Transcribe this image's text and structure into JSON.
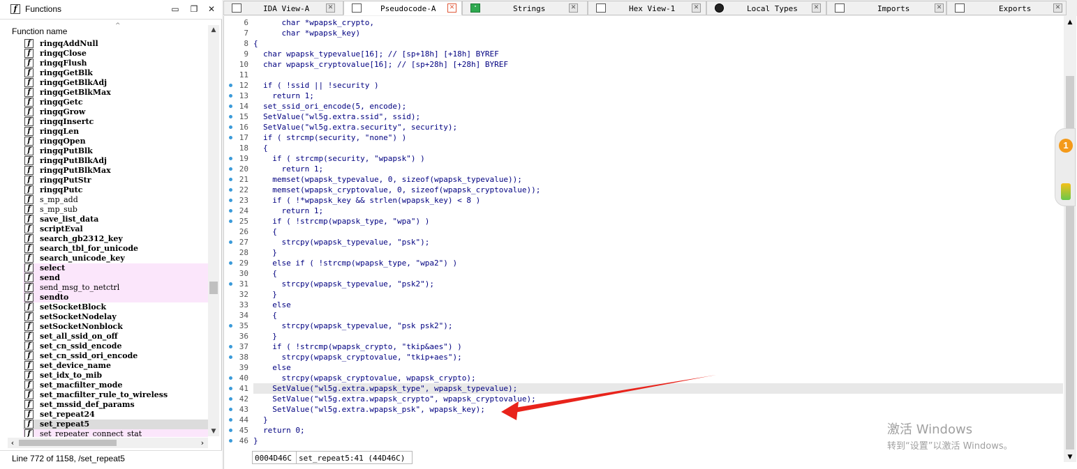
{
  "functions_panel": {
    "title": "Functions",
    "icon": "function-icon",
    "header": "Function name",
    "status": "Line 772 of 1158, /set_repeat5",
    "items": [
      {
        "name": "ringqAddNull",
        "kind": "normal"
      },
      {
        "name": "ringqClose",
        "kind": "normal"
      },
      {
        "name": "ringqFlush",
        "kind": "normal"
      },
      {
        "name": "ringqGetBlk",
        "kind": "normal"
      },
      {
        "name": "ringqGetBlkAdj",
        "kind": "normal"
      },
      {
        "name": "ringqGetBlkMax",
        "kind": "normal"
      },
      {
        "name": "ringqGetc",
        "kind": "normal"
      },
      {
        "name": "ringqGrow",
        "kind": "normal"
      },
      {
        "name": "ringqInsertc",
        "kind": "normal"
      },
      {
        "name": "ringqLen",
        "kind": "normal"
      },
      {
        "name": "ringqOpen",
        "kind": "normal"
      },
      {
        "name": "ringqPutBlk",
        "kind": "normal"
      },
      {
        "name": "ringqPutBlkAdj",
        "kind": "normal"
      },
      {
        "name": "ringqPutBlkMax",
        "kind": "normal"
      },
      {
        "name": "ringqPutStr",
        "kind": "normal"
      },
      {
        "name": "ringqPutc",
        "kind": "normal"
      },
      {
        "name": "s_mp_add",
        "kind": "lib"
      },
      {
        "name": "s_mp_sub",
        "kind": "lib"
      },
      {
        "name": "save_list_data",
        "kind": "normal"
      },
      {
        "name": "scriptEval",
        "kind": "normal"
      },
      {
        "name": "search_gb2312_key",
        "kind": "normal"
      },
      {
        "name": "search_tbl_for_unicode",
        "kind": "normal"
      },
      {
        "name": "search_unicode_key",
        "kind": "normal"
      },
      {
        "name": "select",
        "kind": "import"
      },
      {
        "name": "send",
        "kind": "import"
      },
      {
        "name": "send_msg_to_netctrl",
        "kind": "import-lib"
      },
      {
        "name": "sendto",
        "kind": "import"
      },
      {
        "name": "setSocketBlock",
        "kind": "normal"
      },
      {
        "name": "setSocketNodelay",
        "kind": "normal"
      },
      {
        "name": "setSocketNonblock",
        "kind": "normal"
      },
      {
        "name": "set_all_ssid_on_off",
        "kind": "normal"
      },
      {
        "name": "set_cn_ssid_encode",
        "kind": "normal"
      },
      {
        "name": "set_cn_ssid_ori_encode",
        "kind": "normal"
      },
      {
        "name": "set_device_name",
        "kind": "normal"
      },
      {
        "name": "set_idx_to_mib",
        "kind": "normal"
      },
      {
        "name": "set_macfilter_mode",
        "kind": "normal"
      },
      {
        "name": "set_macfilter_rule_to_wireless",
        "kind": "normal"
      },
      {
        "name": "set_mssid_def_params",
        "kind": "normal"
      },
      {
        "name": "set_repeat24",
        "kind": "normal"
      },
      {
        "name": "set_repeat5",
        "kind": "selected"
      },
      {
        "name": "set_repeater_connect_stat",
        "kind": "import-lib"
      }
    ]
  },
  "tabs": [
    {
      "label": "IDA View-A",
      "icon": "disassembly-icon",
      "active": false
    },
    {
      "label": "Pseudocode-A",
      "icon": "pseudocode-icon",
      "active": true
    },
    {
      "label": "Strings",
      "icon": "strings-icon",
      "active": false
    },
    {
      "label": "Hex View-1",
      "icon": "hex-view-icon",
      "active": false
    },
    {
      "label": "Local Types",
      "icon": "local-types-icon",
      "active": false
    },
    {
      "label": "Imports",
      "icon": "imports-icon",
      "active": false
    },
    {
      "label": "Exports",
      "icon": "exports-icon",
      "active": false
    }
  ],
  "code": {
    "lines": [
      {
        "n": "6",
        "text": "    char *wpapsk_crypto,",
        "dot": false
      },
      {
        "n": "7",
        "text": "    char *wpapsk_key)",
        "dot": false
      },
      {
        "n": "8",
        "text": "{",
        "dot": false,
        "outdent": true
      },
      {
        "n": "9",
        "text": "char wpapsk_typevalue[16]; // [sp+18h] [+18h] BYREF",
        "dot": false
      },
      {
        "n": "10",
        "text": "char wpapsk_cryptovalue[16]; // [sp+28h] [+28h] BYREF",
        "dot": false
      },
      {
        "n": "11",
        "text": "",
        "dot": false
      },
      {
        "n": "12",
        "text": "if ( !ssid || !security )",
        "dot": true
      },
      {
        "n": "13",
        "text": "  return 1;",
        "dot": true
      },
      {
        "n": "14",
        "text": "set_ssid_ori_encode(5, encode);",
        "dot": true
      },
      {
        "n": "15",
        "text": "SetValue(\"wl5g.extra.ssid\", ssid);",
        "dot": true
      },
      {
        "n": "16",
        "text": "SetValue(\"wl5g.extra.security\", security);",
        "dot": true
      },
      {
        "n": "17",
        "text": "if ( strcmp(security, \"none\") )",
        "dot": true
      },
      {
        "n": "18",
        "text": "{",
        "dot": false
      },
      {
        "n": "19",
        "text": "  if ( strcmp(security, \"wpapsk\") )",
        "dot": true
      },
      {
        "n": "20",
        "text": "    return 1;",
        "dot": true
      },
      {
        "n": "21",
        "text": "  memset(wpapsk_typevalue, 0, sizeof(wpapsk_typevalue));",
        "dot": true
      },
      {
        "n": "22",
        "text": "  memset(wpapsk_cryptovalue, 0, sizeof(wpapsk_cryptovalue));",
        "dot": true
      },
      {
        "n": "23",
        "text": "  if ( !*wpapsk_key && strlen(wpapsk_key) < 8 )",
        "dot": true
      },
      {
        "n": "24",
        "text": "    return 1;",
        "dot": true
      },
      {
        "n": "25",
        "text": "  if ( !strcmp(wpapsk_type, \"wpa\") )",
        "dot": true
      },
      {
        "n": "26",
        "text": "  {",
        "dot": false
      },
      {
        "n": "27",
        "text": "    strcpy(wpapsk_typevalue, \"psk\");",
        "dot": true
      },
      {
        "n": "28",
        "text": "  }",
        "dot": false
      },
      {
        "n": "29",
        "text": "  else if ( !strcmp(wpapsk_type, \"wpa2\") )",
        "dot": true
      },
      {
        "n": "30",
        "text": "  {",
        "dot": false
      },
      {
        "n": "31",
        "text": "    strcpy(wpapsk_typevalue, \"psk2\");",
        "dot": true
      },
      {
        "n": "32",
        "text": "  }",
        "dot": false
      },
      {
        "n": "33",
        "text": "  else",
        "dot": false
      },
      {
        "n": "34",
        "text": "  {",
        "dot": false
      },
      {
        "n": "35",
        "text": "    strcpy(wpapsk_typevalue, \"psk psk2\");",
        "dot": true
      },
      {
        "n": "36",
        "text": "  }",
        "dot": false
      },
      {
        "n": "37",
        "text": "  if ( !strcmp(wpapsk_crypto, \"tkip&aes\") )",
        "dot": true
      },
      {
        "n": "38",
        "text": "    strcpy(wpapsk_cryptovalue, \"tkip+aes\");",
        "dot": true
      },
      {
        "n": "39",
        "text": "  else",
        "dot": false
      },
      {
        "n": "40",
        "text": "    strcpy(wpapsk_cryptovalue, wpapsk_crypto);",
        "dot": true
      },
      {
        "n": "41",
        "text": "  SetValue(\"wl5g.extra.wpapsk_type\", wpapsk_typevalue);",
        "dot": true,
        "highlight": true
      },
      {
        "n": "42",
        "text": "  SetValue(\"wl5g.extra.wpapsk_crypto\", wpapsk_cryptovalue);",
        "dot": true
      },
      {
        "n": "43",
        "text": "  SetValue(\"wl5g.extra.wpapsk_psk\", wpapsk_key);",
        "dot": true
      },
      {
        "n": "44",
        "text": "}",
        "dot": true
      },
      {
        "n": "45",
        "text": "return 0;",
        "dot": true
      },
      {
        "n": "46",
        "text": "}",
        "dot": true,
        "outdent": true
      }
    ],
    "status_address": "0004D46C",
    "status_function": "set_repeat5:41 (44D46C)"
  },
  "side_widget": {
    "badge": "1"
  },
  "watermark": {
    "title": "激活 Windows",
    "subtitle": "转到“设置”以激活 Windows。"
  },
  "colors": {
    "code_text": "#000080",
    "arrow": "#e8231b",
    "import_row": "#fbe6fb"
  }
}
